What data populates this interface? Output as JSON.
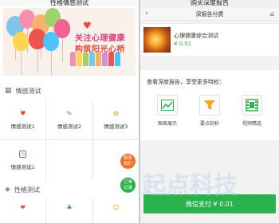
{
  "left": {
    "title": "性格情感测试",
    "banner": {
      "line1": "关注心理健康",
      "line2": "构筑阳光心桥"
    },
    "section1": {
      "label": "情感测试"
    },
    "section1_items": [
      {
        "label": "情感测试1",
        "icon": "heart-icon",
        "color": "#e84a3a"
      },
      {
        "label": "情感测试2",
        "icon": "tag-icon",
        "color": "#e84a3a"
      },
      {
        "label": "情感测试3",
        "icon": "flower-icon",
        "color": "#f5a623"
      },
      {
        "label": "情感测试1",
        "icon": "tag-icon",
        "color": "#555555"
      }
    ],
    "section2": {
      "label": "性格测试"
    },
    "float_buttons": [
      {
        "label_top": "联系",
        "label_bottom": "我们",
        "color": "#f36f21"
      },
      {
        "label_top": "订单",
        "label_bottom": "记录",
        "color": "#2bb24c"
      }
    ]
  },
  "right": {
    "title": "购买深度报告",
    "nav_title": "深报告付费",
    "product": {
      "name": "心理健康综合测试",
      "price": "¥ 0.01"
    },
    "feature_title": "查看深度报告，享受更多特权：",
    "features": [
      {
        "label": "图表展示",
        "icon": "chart-icon",
        "color": "#2bb24c"
      },
      {
        "label": "要点剖析",
        "icon": "funnel-icon",
        "color": "#f5a623"
      },
      {
        "label": "视频精选",
        "icon": "film-icon",
        "color": "#2bb24c"
      }
    ],
    "pay_button": "微信支付 ¥ 0.01"
  },
  "watermark": "起点科技",
  "colors": {
    "wechat_green": "#2bb24c",
    "accent_orange": "#f36f21"
  }
}
